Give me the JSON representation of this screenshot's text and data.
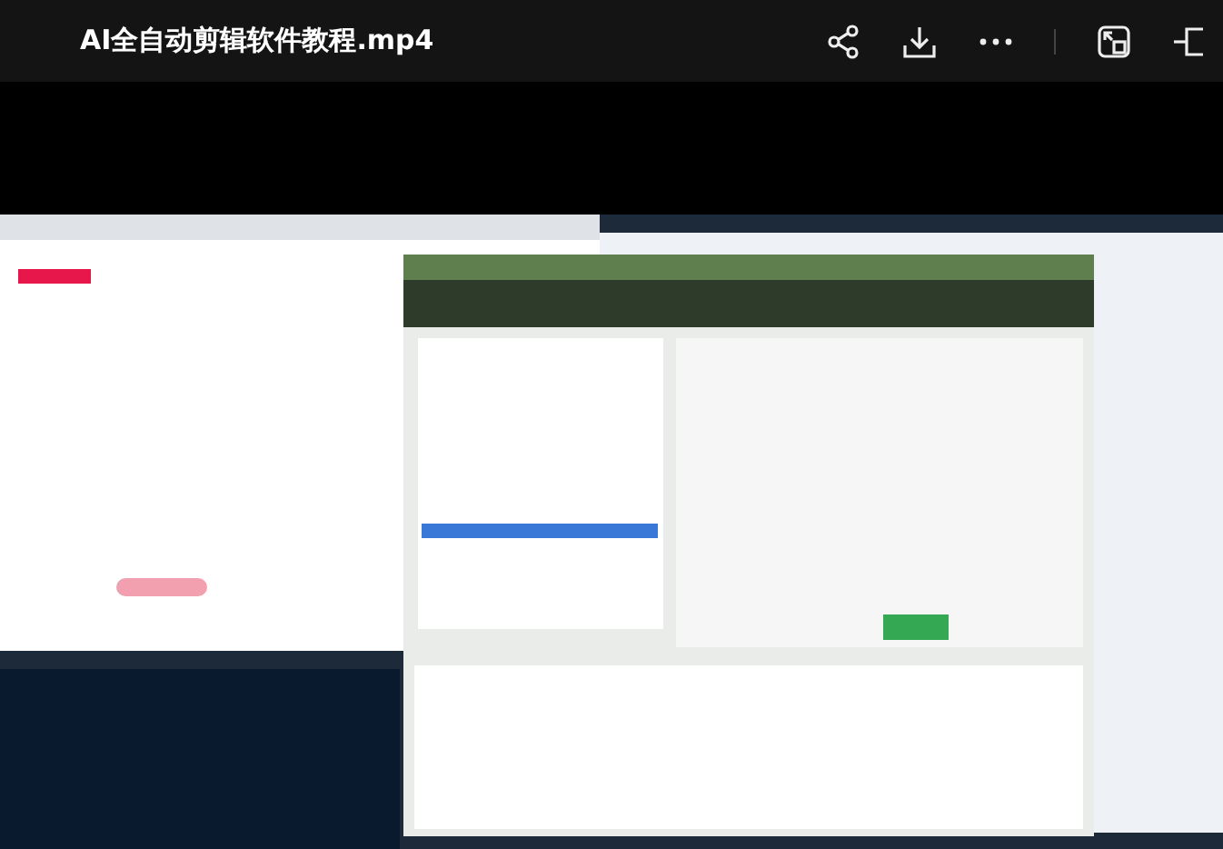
{
  "player": {
    "title": "AI全自动剪辑软件教程.mp4"
  }
}
